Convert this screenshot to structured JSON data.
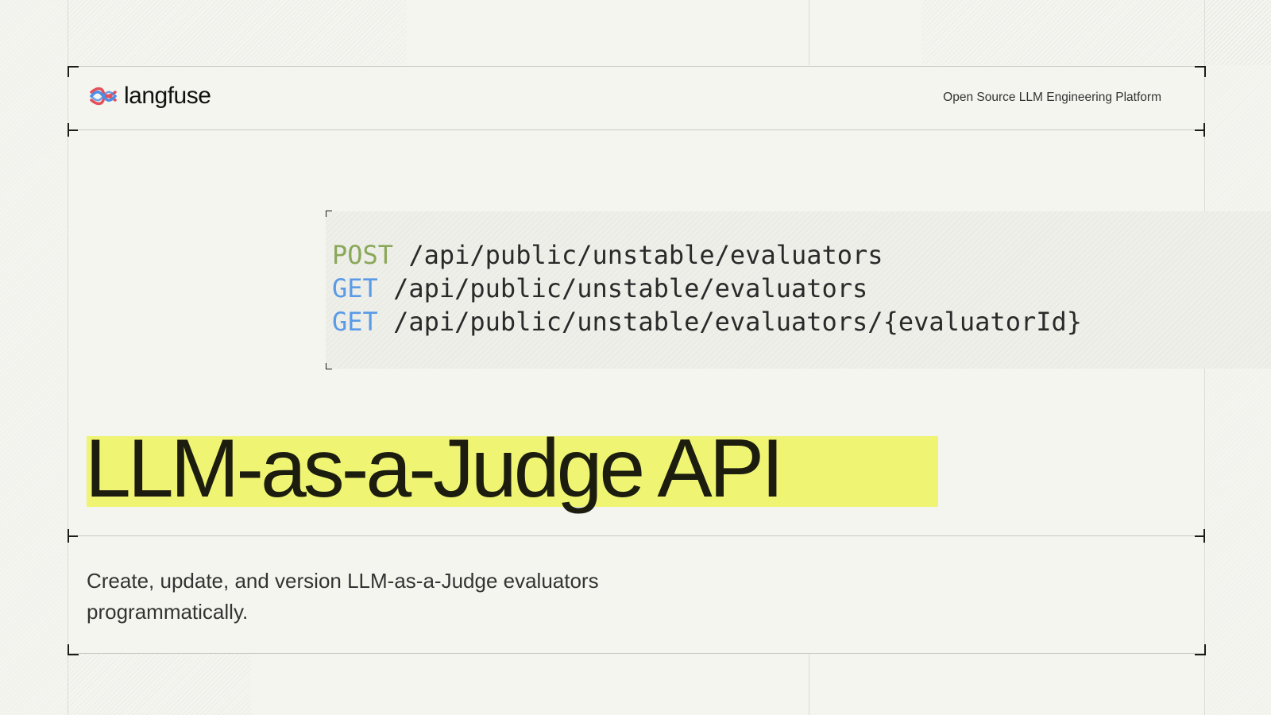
{
  "brand": {
    "name": "langfuse",
    "tagline": "Open Source LLM Engineering Platform",
    "logo_colors": [
      "#e3505a",
      "#4a8ee8"
    ]
  },
  "endpoints": [
    {
      "method": "POST",
      "path": " /api/public/unstable/evaluators"
    },
    {
      "method": "GET",
      "path": " /api/public/unstable/evaluators"
    },
    {
      "method": "GET",
      "path": " /api/public/unstable/evaluators/{evaluatorId}"
    }
  ],
  "headline": "LLM-as-a-Judge API",
  "description": "Create, update, and version LLM-as-a-Judge evaluators programmatically.",
  "colors": {
    "post": "#8aa85a",
    "get": "#5a9ae6",
    "highlight": "#eff573",
    "background": "#f5f5f0"
  }
}
